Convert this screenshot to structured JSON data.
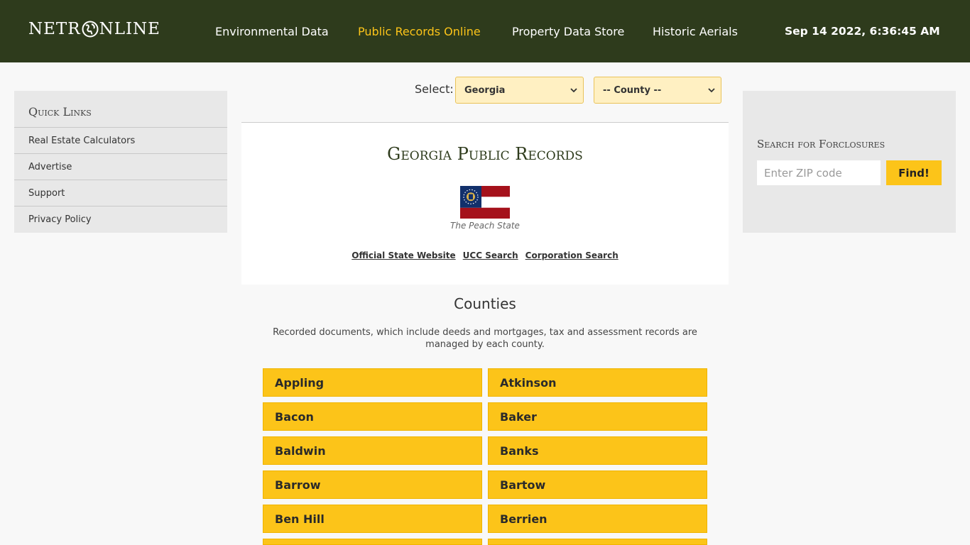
{
  "header": {
    "logo_left": "NETR",
    "logo_right": "NLINE",
    "nav": [
      {
        "label": "Environmental Data",
        "active": false
      },
      {
        "label": "Public Records Online",
        "active": true
      },
      {
        "label": "Property Data Store",
        "active": false
      },
      {
        "label": "Historic Aerials",
        "active": false
      }
    ],
    "clock": "Sep 14 2022, 6:36:45 AM"
  },
  "quick_links": {
    "title": "Quick Links",
    "items": [
      "Real Estate Calculators",
      "Advertise",
      "Support",
      "Privacy Policy"
    ]
  },
  "selector": {
    "label": "Select:",
    "state": "Georgia",
    "county": "-- County --"
  },
  "foreclosure": {
    "title": "Search for Forclosures",
    "zip_placeholder": "Enter ZIP code",
    "button": "Find!"
  },
  "state_card": {
    "title": "Georgia Public Records",
    "motto": "The Peach State",
    "links": [
      "Official State Website",
      "UCC Search",
      "Corporation Search"
    ]
  },
  "counties": {
    "title": "Counties",
    "description": "Recorded documents, which include deeds and mortgages, tax and assessment records are managed by each county.",
    "items": [
      "Appling",
      "Atkinson",
      "Bacon",
      "Baker",
      "Baldwin",
      "Banks",
      "Barrow",
      "Bartow",
      "Ben Hill",
      "Berrien",
      "",
      ""
    ]
  },
  "colors": {
    "header_bg": "#2e3b1c",
    "accent": "#fcc419",
    "active_nav": "#fcc419"
  }
}
